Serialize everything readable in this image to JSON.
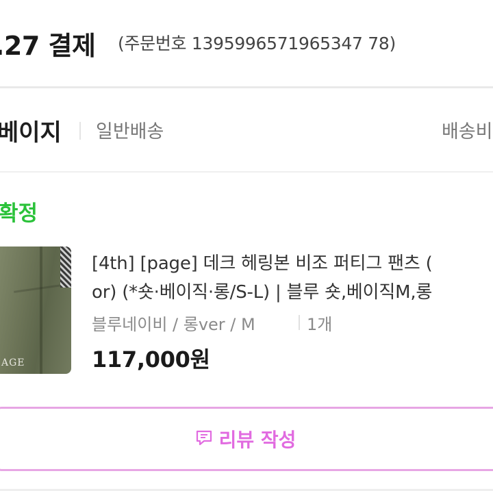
{
  "header": {
    "order_date": ".27 결제",
    "order_number": "(주문번호 1395996571965347 78)"
  },
  "seller": {
    "name": "베이지",
    "shipping_type": "일반배송",
    "shipping_fee_label": "배송비"
  },
  "status": "확정",
  "product": {
    "title_line1": "[4th] [page] 데크 헤링본 비조 퍼티그 팬츠 (",
    "title_line2": "or) (*숏·베이직·롱/S-L) | 블루 숏,베이직M,롱",
    "option": "블루네이비 / 롱ver / M",
    "quantity": "1개",
    "price": "117,000원",
    "thumbnail_text": "AGE"
  },
  "review_button": {
    "label": "리뷰 작성",
    "icon": "review-chat-icon",
    "color": "#e16be0"
  },
  "colors": {
    "status": "#2bc23a",
    "accent": "#e16be0",
    "border": "#e7a6e4"
  }
}
